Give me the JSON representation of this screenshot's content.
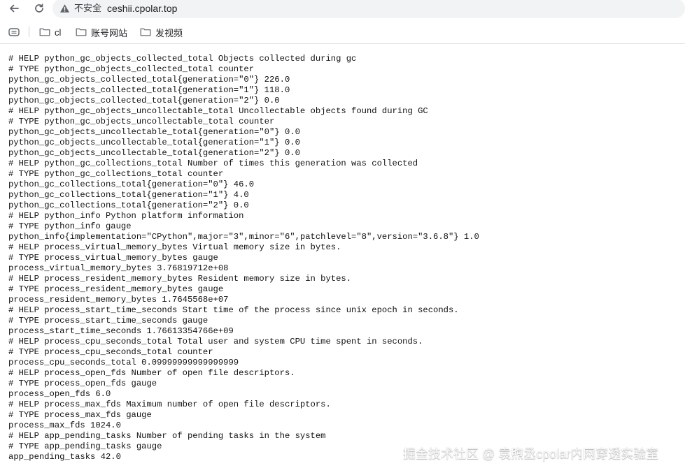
{
  "toolbar": {
    "back_icon": "arrow-left-icon",
    "reload_icon": "reload-icon",
    "security_icon": "warning-triangle-icon",
    "security_label": "不安全",
    "url": "ceshii.cpolar.top"
  },
  "bookmarks": {
    "apps_icon": "grid-icon",
    "items": [
      {
        "label": "cl",
        "icon": "folder-icon"
      },
      {
        "label": "账号网站",
        "icon": "folder-icon"
      },
      {
        "label": "发视频",
        "icon": "folder-icon"
      }
    ]
  },
  "content": {
    "lines": [
      "# HELP python_gc_objects_collected_total Objects collected during gc",
      "# TYPE python_gc_objects_collected_total counter",
      "python_gc_objects_collected_total{generation=\"0\"} 226.0",
      "python_gc_objects_collected_total{generation=\"1\"} 118.0",
      "python_gc_objects_collected_total{generation=\"2\"} 0.0",
      "# HELP python_gc_objects_uncollectable_total Uncollectable objects found during GC",
      "# TYPE python_gc_objects_uncollectable_total counter",
      "python_gc_objects_uncollectable_total{generation=\"0\"} 0.0",
      "python_gc_objects_uncollectable_total{generation=\"1\"} 0.0",
      "python_gc_objects_uncollectable_total{generation=\"2\"} 0.0",
      "# HELP python_gc_collections_total Number of times this generation was collected",
      "# TYPE python_gc_collections_total counter",
      "python_gc_collections_total{generation=\"0\"} 46.0",
      "python_gc_collections_total{generation=\"1\"} 4.0",
      "python_gc_collections_total{generation=\"2\"} 0.0",
      "# HELP python_info Python platform information",
      "# TYPE python_info gauge",
      "python_info{implementation=\"CPython\",major=\"3\",minor=\"6\",patchlevel=\"8\",version=\"3.6.8\"} 1.0",
      "# HELP process_virtual_memory_bytes Virtual memory size in bytes.",
      "# TYPE process_virtual_memory_bytes gauge",
      "process_virtual_memory_bytes 3.76819712e+08",
      "# HELP process_resident_memory_bytes Resident memory size in bytes.",
      "# TYPE process_resident_memory_bytes gauge",
      "process_resident_memory_bytes 1.7645568e+07",
      "# HELP process_start_time_seconds Start time of the process since unix epoch in seconds.",
      "# TYPE process_start_time_seconds gauge",
      "process_start_time_seconds 1.76613354766e+09",
      "# HELP process_cpu_seconds_total Total user and system CPU time spent in seconds.",
      "# TYPE process_cpu_seconds_total counter",
      "process_cpu_seconds_total 0.09999999999999999",
      "# HELP process_open_fds Number of open file descriptors.",
      "# TYPE process_open_fds gauge",
      "process_open_fds 6.0",
      "# HELP process_max_fds Maximum number of open file descriptors.",
      "# TYPE process_max_fds gauge",
      "process_max_fds 1024.0",
      "# HELP app_pending_tasks Number of pending tasks in the system",
      "# TYPE app_pending_tasks gauge",
      "app_pending_tasks 42.0"
    ]
  },
  "watermark": {
    "text": "掘金技术社区 @ 袁煦丞cpolar内网穿透实验室"
  }
}
